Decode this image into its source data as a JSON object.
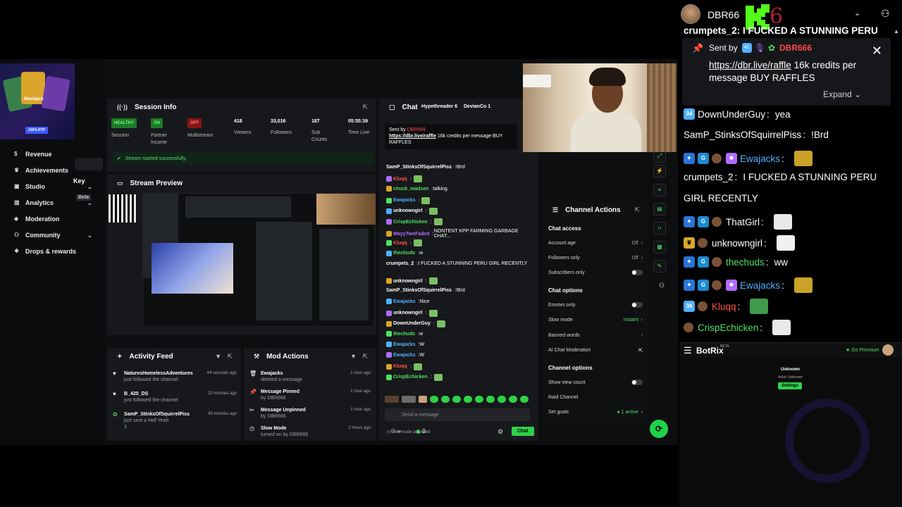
{
  "sidebar": {
    "key_label": "Key",
    "beta_label": "Beta",
    "promo_title": "Blackjack",
    "promo_rtp": "100% RTP",
    "items": [
      {
        "label": "Revenue",
        "icon": "dollar-icon",
        "has_chevron": false
      },
      {
        "label": "Achievements",
        "icon": "trophy-icon",
        "has_chevron": false
      },
      {
        "label": "Studio",
        "icon": "studio-icon",
        "has_chevron": true
      },
      {
        "label": "Analytics",
        "icon": "chart-icon",
        "has_chevron": true
      },
      {
        "label": "Moderation",
        "icon": "shield-icon",
        "has_chevron": false
      },
      {
        "label": "Community",
        "icon": "people-icon",
        "has_chevron": true
      },
      {
        "label": "Drops & rewards",
        "icon": "gift-icon",
        "has_chevron": false
      }
    ]
  },
  "session_info": {
    "title": "Session Info",
    "session": {
      "badge": "HEALTHY",
      "label": "Session"
    },
    "partner": {
      "badge": "ON",
      "label": "Partner Income"
    },
    "multistream": {
      "badge": "OFF",
      "label": "Multistream"
    },
    "viewers": {
      "value": "418",
      "label": "Viewers"
    },
    "followers": {
      "value": "33,016",
      "label": "Followers"
    },
    "subs": {
      "value": "187",
      "label": "Sub Counts"
    },
    "time": {
      "value": "05:55:39",
      "label": "Time Live"
    },
    "status_msg": "Stream started successfully."
  },
  "stream_preview": {
    "title": "Stream Preview"
  },
  "activity_feed": {
    "title": "Activity Feed",
    "items": [
      {
        "name": "NaturesHomelessAdventures",
        "sub": "just followed the channel",
        "time": "44 seconds ago"
      },
      {
        "name": "B_420_DS",
        "sub": "just followed the channel",
        "time": "23 minutes ago"
      },
      {
        "name": "SamP_StinksOfSquirrelPiss",
        "sub": "just sent a Hell Yeah",
        "time": "43 minutes ago",
        "extra": "1"
      }
    ]
  },
  "mod_actions": {
    "title": "Mod Actions",
    "items": [
      {
        "name": "Ewajacks",
        "sub": "deleted a message",
        "time": "1 hour ago"
      },
      {
        "name": "Message Pinned",
        "sub": "by DBR666",
        "time": "1 hour ago"
      },
      {
        "name": "Message Unpinned",
        "sub": "by DBR666",
        "time": "1 hour ago"
      },
      {
        "name": "Slow Mode",
        "sub": "turned on by DBR666",
        "time": "2 hours ago"
      }
    ]
  },
  "chat": {
    "title": "Chat",
    "top_tabs": [
      "Hypethreader 6",
      "DevianCo 1"
    ],
    "pinned_sent": "Sent by",
    "pinned_link": "https://dbr.live/raffle",
    "pinned_text": " 16k credits per message BUY RAFFLES",
    "messages": [
      {
        "user": "SamP_StinksOfSquirrelPiss",
        "text": "!Brd",
        "color": "#ffffff"
      },
      {
        "user": "Kluqq",
        "text": "",
        "color": "#ff4f4f",
        "emote": true
      },
      {
        "user": "chuck_madsen",
        "text": "talking",
        "color": "#4fe063"
      },
      {
        "user": "Ewajacks",
        "text": "",
        "color": "#4fb0ff",
        "emote": true
      },
      {
        "user": "unknowngirl",
        "text": "",
        "color": "#ffffff",
        "emote": true
      },
      {
        "user": "CrispEchicken",
        "text": "",
        "color": "#4fe063",
        "emote": true
      },
      {
        "user": "WayyTwoFaded",
        "text": "NONTENT KPP FARMING GARBAGE CHAT...",
        "color": "#b06bff"
      },
      {
        "user": "Kluqq",
        "text": "",
        "color": "#ff4f4f",
        "emote": true
      },
      {
        "user": "thechuds",
        "text": "w",
        "color": "#4fe063"
      },
      {
        "user": "crumpets_2",
        "text": "I FUCKED A STUNNING PERU GIRL RECENTLY",
        "color": "#ffffff"
      },
      {
        "user": "unknowngirl",
        "text": "",
        "color": "#ffffff",
        "emote": true
      },
      {
        "user": "SamP_StinksOfSquirrelPiss",
        "text": "!Brd",
        "color": "#ffffff"
      },
      {
        "user": "Ewajacks",
        "text": "Nice",
        "color": "#4fb0ff"
      },
      {
        "user": "unknowngirl",
        "text": "",
        "color": "#ffffff",
        "emote": true
      },
      {
        "user": "DownUnderGuy",
        "text": "",
        "color": "#ffffff",
        "emote": true
      },
      {
        "user": "thechuds",
        "text": "w",
        "color": "#4fe063"
      },
      {
        "user": "Ewajacks",
        "text": "W",
        "color": "#4fb0ff"
      },
      {
        "user": "Ewajacks",
        "text": "W",
        "color": "#4fb0ff"
      },
      {
        "user": "Kluqq",
        "text": "",
        "color": "#ff4f4f",
        "emote": true
      },
      {
        "user": "CrispEchicken",
        "text": "",
        "color": "#4fe063",
        "emote": true
      }
    ],
    "slow_mode_note": "Slow mode activated",
    "input_placeholder": "Send a message",
    "count": "0",
    "send_label": "Chat"
  },
  "channel_actions": {
    "title": "Channel Actions",
    "chat_access": "Chat access",
    "account_age": {
      "label": "Account age",
      "value": "Off"
    },
    "followers_only": {
      "label": "Followers only",
      "value": "Off"
    },
    "subscribers_only": {
      "label": "Subscribers only"
    },
    "chat_options": "Chat options",
    "emotes_only": {
      "label": "Emotes only"
    },
    "slow_mode": {
      "label": "Slow mode",
      "value": "Instant"
    },
    "banned_words": {
      "label": "Banned words"
    },
    "ai_mod": {
      "label": "AI Chat Moderation"
    },
    "channel_options": "Channel options",
    "show_view_count": {
      "label": "Show view count"
    },
    "raid": {
      "label": "Raid Channel"
    },
    "set_goals": {
      "label": "Set goals",
      "value": "1 active"
    }
  },
  "right_chat": {
    "channel_name": "DBR66",
    "logo_letter": "K",
    "logo_digit": "6",
    "top_partial": "crumpets_2: I FUCKED A STUNNING PERU",
    "pinned": {
      "sent_by": "Sent by",
      "badge_num": "41",
      "user": "DBR666",
      "link": "https://dbr.live/raffle",
      "text": " 16k credits per message BUY RAFFLES",
      "expand": "Expand"
    },
    "messages": [
      {
        "badge": "34",
        "user": "DownUnderGuy",
        "text": "yea",
        "color": "#ffffff",
        "emote": false
      },
      {
        "badge": "",
        "user": "SamP_StinksOfSquirrelPiss",
        "text": "!Brd",
        "color": "#ffffff",
        "emote": false
      },
      {
        "badge": "",
        "user": "Ewajacks",
        "text": "",
        "color": "#4fb0ff",
        "emote": true
      },
      {
        "badge": "",
        "user": "crumpets_2",
        "text": "I FUCKED A STUNNING PERU",
        "color": "#ffffff",
        "emote": false
      },
      {
        "badge": "",
        "user": "",
        "text": "GIRL RECENTLY",
        "color": "#ffffff",
        "emote": false
      },
      {
        "badge": "",
        "user": "ThatGirl",
        "text": "",
        "color": "#ffffff",
        "emote": true
      },
      {
        "badge": "",
        "user": "unknowngirl",
        "text": "",
        "color": "#ffffff",
        "emote": true
      },
      {
        "badge": "",
        "user": "thechuds",
        "text": "ww",
        "color": "#4fe063",
        "emote": false
      },
      {
        "badge": "",
        "user": "Ewajacks",
        "text": "",
        "color": "#4fb0ff",
        "emote": true
      },
      {
        "badge": "36",
        "user": "Kluqq",
        "text": "",
        "color": "#ff4f4f",
        "emote": true
      },
      {
        "badge": "",
        "user": "CrispEchicken",
        "text": "",
        "color": "#4fe063",
        "emote": true
      }
    ]
  },
  "botrix": {
    "name": "BotRix",
    "beta": "BETA",
    "go_premium": "Go Premium",
    "unknown": "Unknown",
    "artist": "Artist: Unknown",
    "settings": "Settings"
  },
  "colors": {
    "accent": "#2fd149",
    "brand_green": "#53fc18",
    "danger": "#ff4747"
  }
}
